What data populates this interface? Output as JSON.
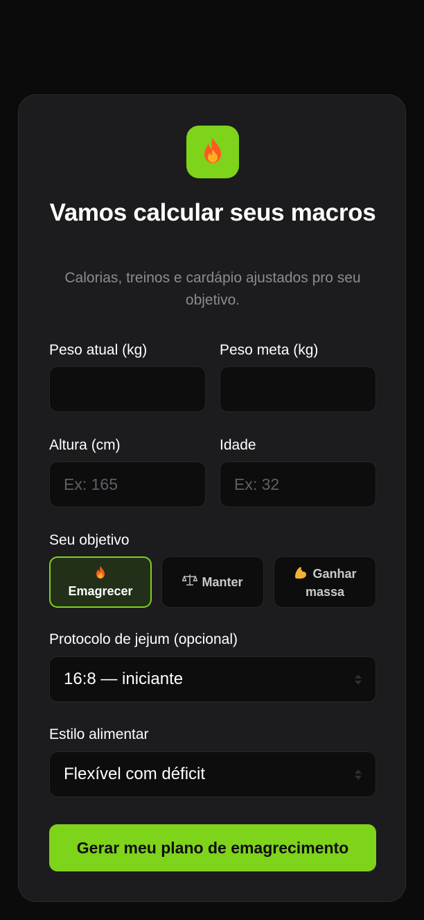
{
  "colors": {
    "accent": "#7ed31b",
    "page_background": "#0b0b0c",
    "card_background": "#1c1c1e",
    "input_background": "#0d0d0e",
    "muted_text": "#8b8b91"
  },
  "header": {
    "icon": "fire-icon",
    "title": "Vamos calcular seus macros",
    "subtitle": "Calorias, treinos e cardápio ajustados pro seu objetivo."
  },
  "form": {
    "peso_atual": {
      "label": "Peso atual (kg)",
      "value": "",
      "placeholder": ""
    },
    "peso_meta": {
      "label": "Peso meta (kg)",
      "value": "",
      "placeholder": ""
    },
    "altura": {
      "label": "Altura (cm)",
      "value": "",
      "placeholder": "Ex: 165"
    },
    "idade": {
      "label": "Idade",
      "value": "",
      "placeholder": "Ex: 32"
    },
    "objetivo": {
      "label": "Seu objetivo",
      "options": [
        {
          "icon": "fire-icon",
          "label": "Emagrecer",
          "selected": true
        },
        {
          "icon": "scale-icon",
          "label": "Manter",
          "selected": false
        },
        {
          "icon": "flexed-biceps-icon",
          "label_line1": "Ganhar",
          "label_line2": "massa",
          "selected": false
        }
      ]
    },
    "jejum": {
      "label": "Protocolo de jejum (opcional)",
      "selected": "16:8 — iniciante"
    },
    "estilo": {
      "label": "Estilo alimentar",
      "selected": "Flexível com déficit"
    },
    "submit_label": "Gerar meu plano de emagrecimento"
  }
}
